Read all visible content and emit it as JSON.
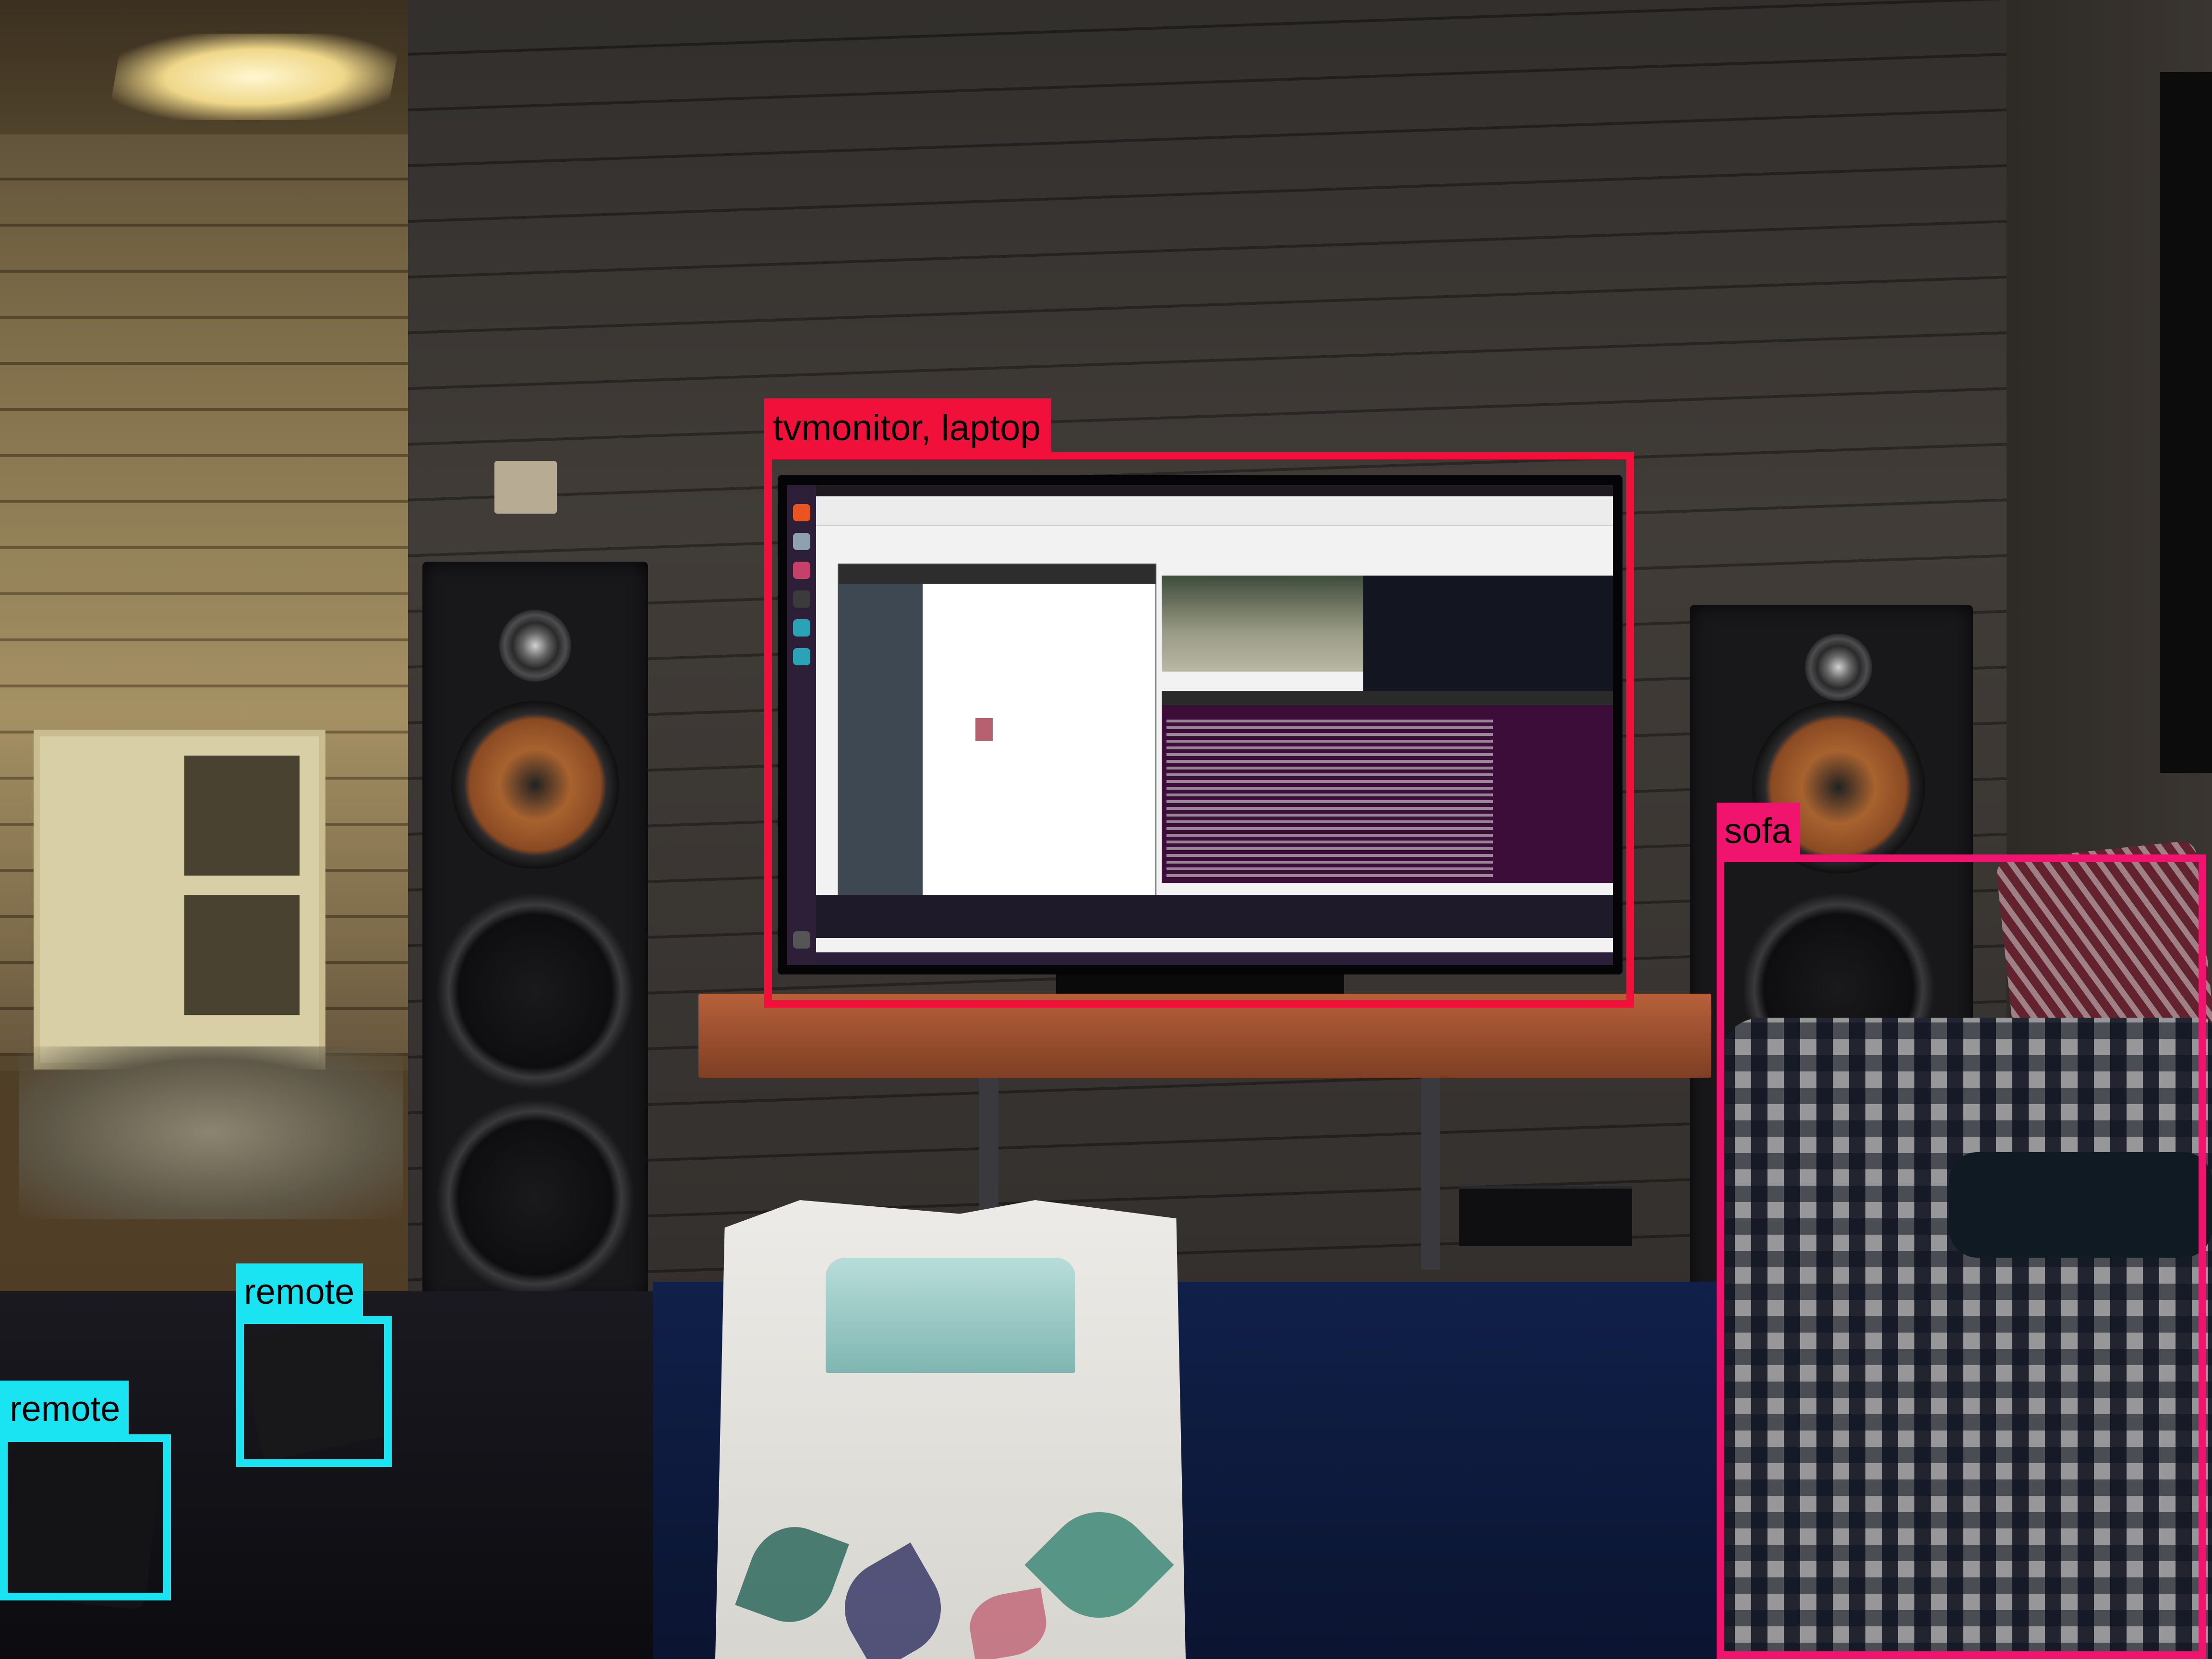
{
  "image": {
    "kind": "object-detection-overlay"
  },
  "colors": {
    "tvmonitor": "#f0103a",
    "sofa": "#f0146e",
    "remote": "#1be4f2"
  },
  "detections": [
    {
      "label": "tvmonitor, laptop",
      "color": "#f0103a"
    },
    {
      "label": "sofa",
      "color": "#f0146e"
    },
    {
      "label": "remote",
      "color": "#1be4f2"
    },
    {
      "label": "remote",
      "color": "#1be4f2"
    }
  ]
}
